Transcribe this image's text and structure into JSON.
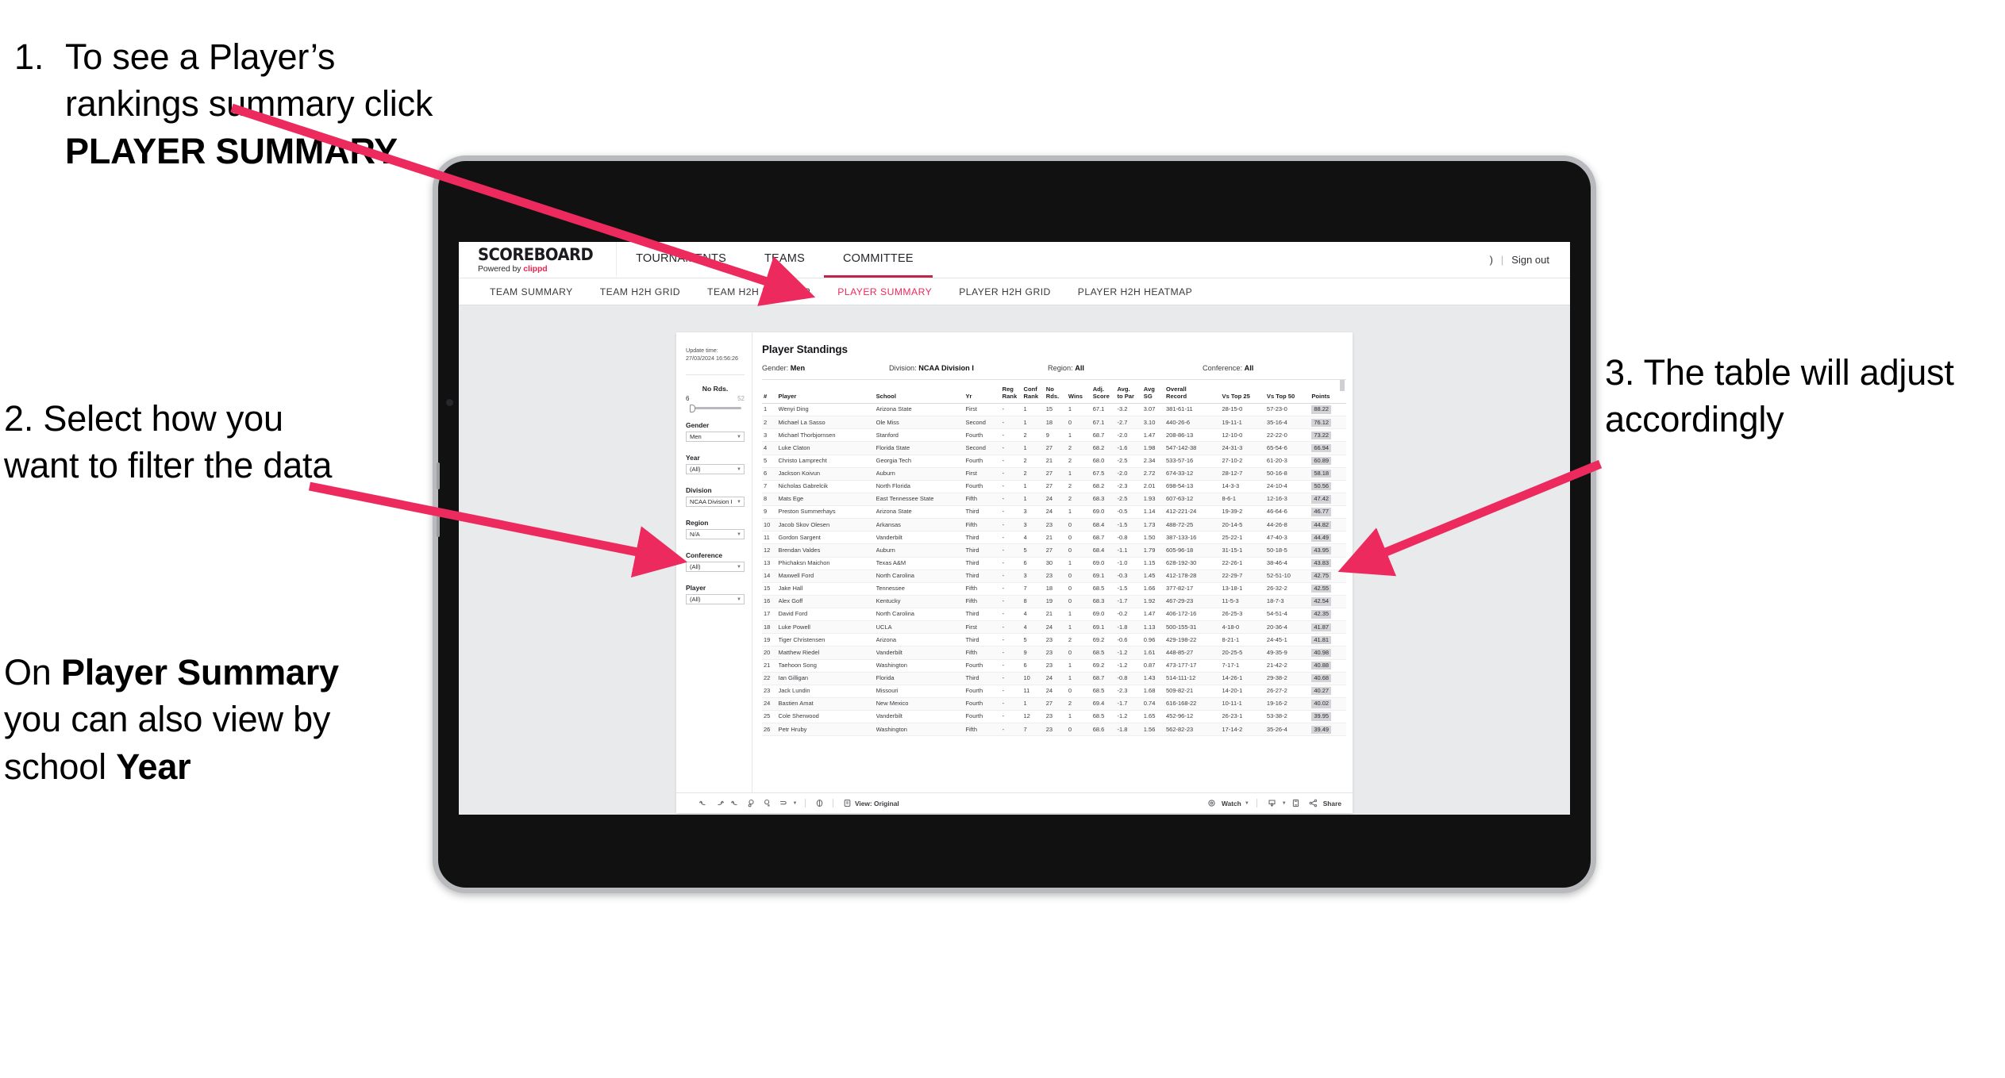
{
  "annotations": {
    "step1": {
      "number": "1.",
      "text_before": "To see a Player’s rankings summary click ",
      "bold": "PLAYER SUMMARY"
    },
    "step2": {
      "line": "2. Select how you want to filter the data"
    },
    "step2b": {
      "pre": "On ",
      "bold1": "Player Summary",
      "mid": " you can also view by school ",
      "bold2": "Year"
    },
    "step3": {
      "line": "3. The table will adjust accordingly"
    }
  },
  "colors": {
    "arrow": "#ec2a5e",
    "accent": "#ec2a5e",
    "brand": "#e8264f",
    "tab_underline": "#c2254a"
  },
  "app": {
    "logo": {
      "word": "SCOREBOARD",
      "sub_pre": "Powered by ",
      "sub_brand": "clippd"
    },
    "top_nav": [
      {
        "label": "TOURNAMENTS",
        "active": false
      },
      {
        "label": "TEAMS",
        "active": false
      },
      {
        "label": "COMMITTEE",
        "active": true
      }
    ],
    "top_right": {
      "user_glyph": ")",
      "separator": "|",
      "sign_out": "Sign out"
    },
    "sub_nav": [
      {
        "label": "TEAM SUMMARY",
        "active": false
      },
      {
        "label": "TEAM H2H GRID",
        "active": false
      },
      {
        "label": "TEAM H2H HEATMAP",
        "active": false
      },
      {
        "label": "PLAYER SUMMARY",
        "active": true
      },
      {
        "label": "PLAYER H2H GRID",
        "active": false
      },
      {
        "label": "PLAYER H2H HEATMAP",
        "active": false
      }
    ]
  },
  "filters": {
    "update_label": "Update time:",
    "update_value": "27/03/2024 16:56:26",
    "slider": {
      "label": "No Rds.",
      "min": "6",
      "max": "52",
      "value_pct": 6
    },
    "selects": [
      {
        "label": "Gender",
        "value": "Men"
      },
      {
        "label": "Year",
        "value": "(All)"
      },
      {
        "label": "Division",
        "value": "NCAA Division I"
      },
      {
        "label": "Region",
        "value": "N/A"
      },
      {
        "label": "Conference",
        "value": "(All)"
      },
      {
        "label": "Player",
        "value": "(All)"
      }
    ]
  },
  "table": {
    "title": "Player Standings",
    "filter_summary": [
      {
        "label": "Gender: ",
        "value": "Men"
      },
      {
        "label": "Division: ",
        "value": "NCAA Division I"
      },
      {
        "label": "Region: ",
        "value": "All"
      },
      {
        "label": "Conference: ",
        "value": "All"
      }
    ],
    "columns": [
      {
        "l1": "#",
        "l2": ""
      },
      {
        "l1": "Player",
        "l2": ""
      },
      {
        "l1": "School",
        "l2": ""
      },
      {
        "l1": "Yr",
        "l2": ""
      },
      {
        "l1": "Reg",
        "l2": "Rank"
      },
      {
        "l1": "Conf",
        "l2": "Rank"
      },
      {
        "l1": "No",
        "l2": "Rds."
      },
      {
        "l1": "Wins",
        "l2": ""
      },
      {
        "l1": "Adj.",
        "l2": "Score"
      },
      {
        "l1": "Avg.",
        "l2": "to Par"
      },
      {
        "l1": "Avg",
        "l2": "SG"
      },
      {
        "l1": "Overall",
        "l2": "Record"
      },
      {
        "l1": "Vs Top 25",
        "l2": ""
      },
      {
        "l1": "Vs Top 50",
        "l2": ""
      },
      {
        "l1": "Points",
        "l2": ""
      }
    ],
    "rows": [
      [
        "1",
        "Wenyi Ding",
        "Arizona State",
        "First",
        "-",
        "1",
        "15",
        "1",
        "67.1",
        "-3.2",
        "3.07",
        "381-61-11",
        "28-15-0",
        "57-23-0",
        "88.22"
      ],
      [
        "2",
        "Michael La Sasso",
        "Ole Miss",
        "Second",
        "-",
        "1",
        "18",
        "0",
        "67.1",
        "-2.7",
        "3.10",
        "440-26-6",
        "19-11-1",
        "35-16-4",
        "76.12"
      ],
      [
        "3",
        "Michael Thorbjornsen",
        "Stanford",
        "Fourth",
        "-",
        "2",
        "9",
        "1",
        "68.7",
        "-2.0",
        "1.47",
        "208-86-13",
        "12-10-0",
        "22-22-0",
        "73.22"
      ],
      [
        "4",
        "Luke Claton",
        "Florida State",
        "Second",
        "-",
        "1",
        "27",
        "2",
        "68.2",
        "-1.6",
        "1.98",
        "547-142-38",
        "24-31-3",
        "65-54-6",
        "66.94"
      ],
      [
        "5",
        "Christo Lamprecht",
        "Georgia Tech",
        "Fourth",
        "-",
        "2",
        "21",
        "2",
        "68.0",
        "-2.5",
        "2.34",
        "533-57-16",
        "27-10-2",
        "61-20-3",
        "60.89"
      ],
      [
        "6",
        "Jackson Koivun",
        "Auburn",
        "First",
        "-",
        "2",
        "27",
        "1",
        "67.5",
        "-2.0",
        "2.72",
        "674-33-12",
        "28-12-7",
        "50-16-8",
        "58.18"
      ],
      [
        "7",
        "Nicholas Gabrelcik",
        "North Florida",
        "Fourth",
        "-",
        "1",
        "27",
        "2",
        "68.2",
        "-2.3",
        "2.01",
        "698-54-13",
        "14-3-3",
        "24-10-4",
        "50.56"
      ],
      [
        "8",
        "Mats Ege",
        "East Tennessee State",
        "Fifth",
        "-",
        "1",
        "24",
        "2",
        "68.3",
        "-2.5",
        "1.93",
        "607-63-12",
        "8-6-1",
        "12-16-3",
        "47.42"
      ],
      [
        "9",
        "Preston Summerhays",
        "Arizona State",
        "Third",
        "-",
        "3",
        "24",
        "1",
        "69.0",
        "-0.5",
        "1.14",
        "412-221-24",
        "19-39-2",
        "46-64-6",
        "46.77"
      ],
      [
        "10",
        "Jacob Skov Olesen",
        "Arkansas",
        "Fifth",
        "-",
        "3",
        "23",
        "0",
        "68.4",
        "-1.5",
        "1.73",
        "488-72-25",
        "20-14-5",
        "44-26-8",
        "44.82"
      ],
      [
        "11",
        "Gordon Sargent",
        "Vanderbilt",
        "Third",
        "-",
        "4",
        "21",
        "0",
        "68.7",
        "-0.8",
        "1.50",
        "387-133-16",
        "25-22-1",
        "47-40-3",
        "44.49"
      ],
      [
        "12",
        "Brendan Valdes",
        "Auburn",
        "Third",
        "-",
        "5",
        "27",
        "0",
        "68.4",
        "-1.1",
        "1.79",
        "605-96-18",
        "31-15-1",
        "50-18-5",
        "43.95"
      ],
      [
        "13",
        "Phichaksn Maichon",
        "Texas A&M",
        "Third",
        "-",
        "6",
        "30",
        "1",
        "69.0",
        "-1.0",
        "1.15",
        "628-192-30",
        "22-26-1",
        "38-46-4",
        "43.83"
      ],
      [
        "14",
        "Maxwell Ford",
        "North Carolina",
        "Third",
        "-",
        "3",
        "23",
        "0",
        "69.1",
        "-0.3",
        "1.45",
        "412-178-28",
        "22-29-7",
        "52-51-10",
        "42.75"
      ],
      [
        "15",
        "Jake Hall",
        "Tennessee",
        "Fifth",
        "-",
        "7",
        "18",
        "0",
        "68.5",
        "-1.5",
        "1.66",
        "377-82-17",
        "13-18-1",
        "26-32-2",
        "42.55"
      ],
      [
        "16",
        "Alex Goff",
        "Kentucky",
        "Fifth",
        "-",
        "8",
        "19",
        "0",
        "68.3",
        "-1.7",
        "1.92",
        "467-29-23",
        "11-5-3",
        "18-7-3",
        "42.54"
      ],
      [
        "17",
        "David Ford",
        "North Carolina",
        "Third",
        "-",
        "4",
        "21",
        "1",
        "69.0",
        "-0.2",
        "1.47",
        "406-172-16",
        "26-25-3",
        "54-51-4",
        "42.35"
      ],
      [
        "18",
        "Luke Powell",
        "UCLA",
        "First",
        "-",
        "4",
        "24",
        "1",
        "69.1",
        "-1.8",
        "1.13",
        "500-155-31",
        "4-18-0",
        "20-36-4",
        "41.87"
      ],
      [
        "19",
        "Tiger Christensen",
        "Arizona",
        "Third",
        "-",
        "5",
        "23",
        "2",
        "69.2",
        "-0.6",
        "0.96",
        "429-198-22",
        "8-21-1",
        "24-45-1",
        "41.81"
      ],
      [
        "20",
        "Matthew Riedel",
        "Vanderbilt",
        "Fifth",
        "-",
        "9",
        "23",
        "0",
        "68.5",
        "-1.2",
        "1.61",
        "448-85-27",
        "20-25-5",
        "49-35-9",
        "40.98"
      ],
      [
        "21",
        "Taehoon Song",
        "Washington",
        "Fourth",
        "-",
        "6",
        "23",
        "1",
        "69.2",
        "-1.2",
        "0.87",
        "473-177-17",
        "7-17-1",
        "21-42-2",
        "40.88"
      ],
      [
        "22",
        "Ian Gilligan",
        "Florida",
        "Third",
        "-",
        "10",
        "24",
        "1",
        "68.7",
        "-0.8",
        "1.43",
        "514-111-12",
        "14-26-1",
        "29-38-2",
        "40.68"
      ],
      [
        "23",
        "Jack Lundin",
        "Missouri",
        "Fourth",
        "-",
        "11",
        "24",
        "0",
        "68.5",
        "-2.3",
        "1.68",
        "509-82-21",
        "14-20-1",
        "26-27-2",
        "40.27"
      ],
      [
        "24",
        "Bastien Amat",
        "New Mexico",
        "Fourth",
        "-",
        "1",
        "27",
        "2",
        "69.4",
        "-1.7",
        "0.74",
        "616-168-22",
        "10-11-1",
        "19-16-2",
        "40.02"
      ],
      [
        "25",
        "Cole Sherwood",
        "Vanderbilt",
        "Fourth",
        "-",
        "12",
        "23",
        "1",
        "68.5",
        "-1.2",
        "1.65",
        "452-96-12",
        "26-23-1",
        "53-38-2",
        "39.95"
      ],
      [
        "26",
        "Petr Hruby",
        "Washington",
        "Fifth",
        "-",
        "7",
        "23",
        "0",
        "68.6",
        "-1.8",
        "1.56",
        "562-82-23",
        "17-14-2",
        "35-26-4",
        "39.49"
      ]
    ]
  },
  "toolbar": {
    "view_label": "View: Original",
    "watch_label": "Watch",
    "share_label": "Share"
  }
}
